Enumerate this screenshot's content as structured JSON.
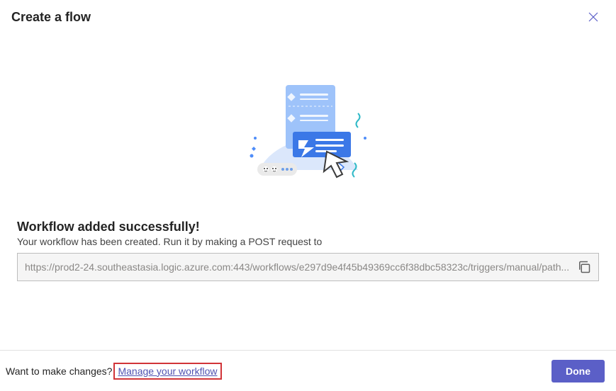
{
  "header": {
    "title": "Create a flow"
  },
  "main": {
    "heading": "Workflow added successfully!",
    "subtext": "Your workflow has been created. Run it by making a POST request to",
    "url": "https://prod2-24.southeastasia.logic.azure.com:443/workflows/e297d9e4f45b49369cc6f38dbc58323c/triggers/manual/path..."
  },
  "footer": {
    "prompt": "Want to make changes?",
    "link": "Manage your workflow",
    "done": "Done"
  }
}
